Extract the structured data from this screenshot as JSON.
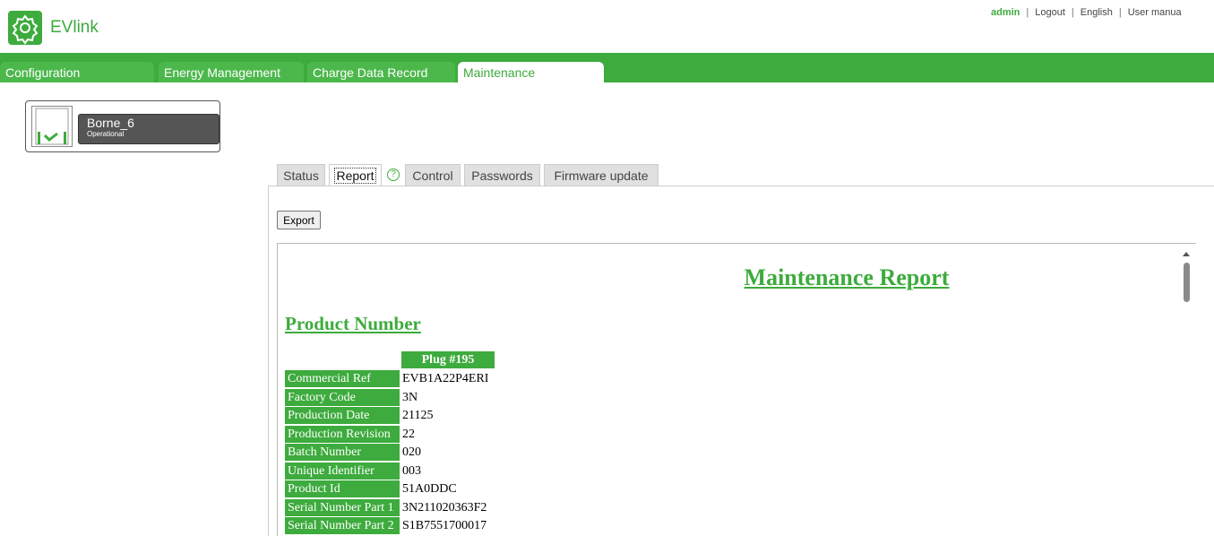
{
  "header": {
    "app_name": "EVlink",
    "logo_icon": "gear-icon",
    "user": "admin",
    "logout": "Logout",
    "language": "English",
    "manual": "User manua"
  },
  "colors": {
    "brand_green": "#3dab3d",
    "station_label_bg": "#555555"
  },
  "nav": {
    "tabs": [
      {
        "label": "Configuration"
      },
      {
        "label": "Energy Management"
      },
      {
        "label": "Charge Data Record"
      },
      {
        "label": "Maintenance",
        "active": true
      }
    ]
  },
  "station": {
    "name": "Borne_6",
    "status": "Operational",
    "icon": "charging-station-icon"
  },
  "sub_tabs": {
    "items": [
      {
        "label": "Status"
      },
      {
        "label": "Report",
        "active": true
      },
      {
        "label": "Control"
      },
      {
        "label": "Passwords"
      },
      {
        "label": "Firmware update"
      }
    ],
    "help_icon": "help-icon"
  },
  "export_label": "Export",
  "report": {
    "title": "Maintenance Report",
    "section_title": "Product Number",
    "column_header": "Plug #195",
    "rows": [
      {
        "label": "Commercial Ref",
        "value": "EVB1A22P4ERI"
      },
      {
        "label": "Factory Code",
        "value": "3N"
      },
      {
        "label": "Production Date",
        "value": "21125"
      },
      {
        "label": "Production Revision",
        "value": "22"
      },
      {
        "label": "Batch Number",
        "value": "020"
      },
      {
        "label": "Unique Identifier",
        "value": "003"
      },
      {
        "label": "Product Id",
        "value": "51A0DDC"
      },
      {
        "label": "Serial Number Part 1",
        "value": "3N211020363F2"
      },
      {
        "label": "Serial Number Part 2",
        "value": "S1B7551700017"
      }
    ]
  }
}
